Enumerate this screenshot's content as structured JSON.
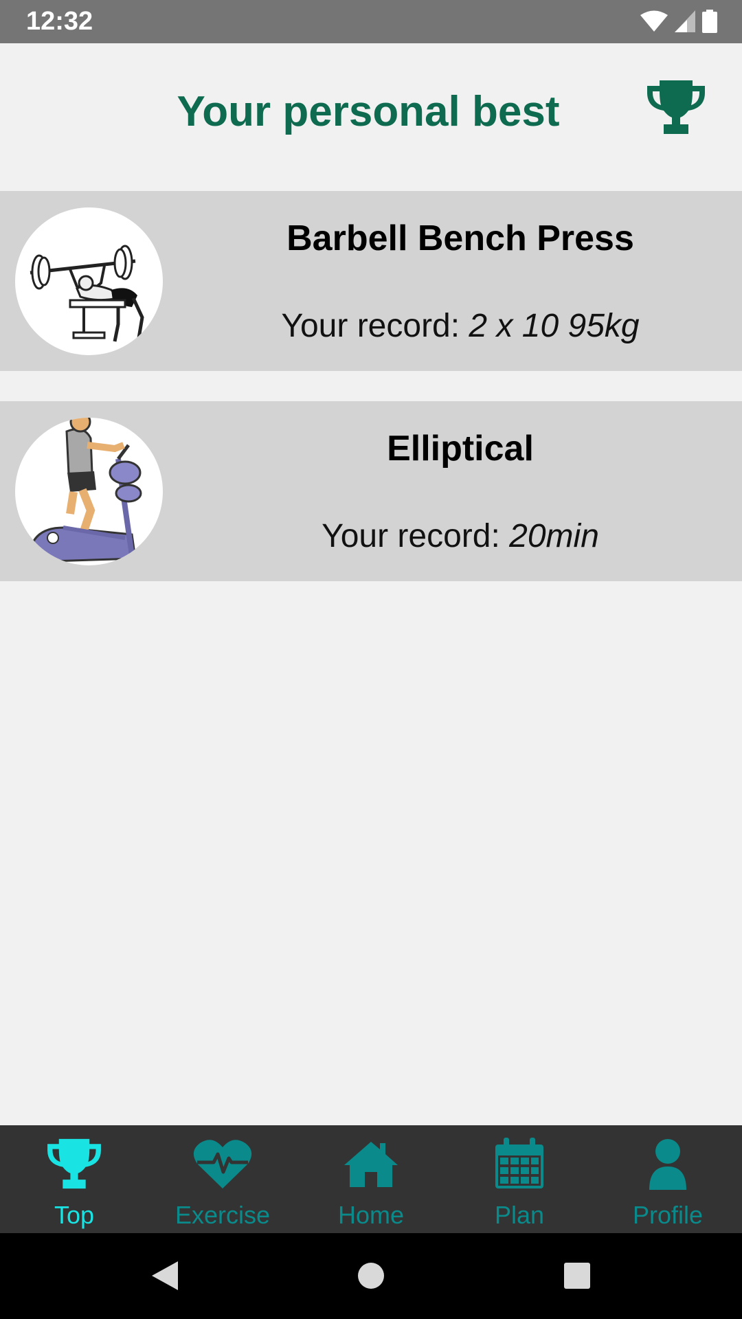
{
  "status_bar": {
    "time": "12:32"
  },
  "header": {
    "title": "Your personal best",
    "title_color": "#0e6b4f",
    "icon": "trophy-icon"
  },
  "records": [
    {
      "name": "Barbell Bench Press",
      "record_label": "Your record: ",
      "record_value": "2 x 10 95kg",
      "image": "bench-press-illustration"
    },
    {
      "name": "Elliptical",
      "record_label": "Your record: ",
      "record_value": "20min",
      "image": "elliptical-illustration"
    }
  ],
  "bottom_nav": {
    "active_color": "#19e3e3",
    "inactive_color": "#0a8a8a",
    "items": [
      {
        "label": "Top",
        "icon": "trophy-icon",
        "active": true
      },
      {
        "label": "Exercise",
        "icon": "heartbeat-icon",
        "active": false
      },
      {
        "label": "Home",
        "icon": "home-icon",
        "active": false
      },
      {
        "label": "Plan",
        "icon": "calendar-icon",
        "active": false
      },
      {
        "label": "Profile",
        "icon": "user-icon",
        "active": false
      }
    ]
  },
  "system_nav": {
    "buttons": [
      "back",
      "home",
      "recents"
    ]
  }
}
